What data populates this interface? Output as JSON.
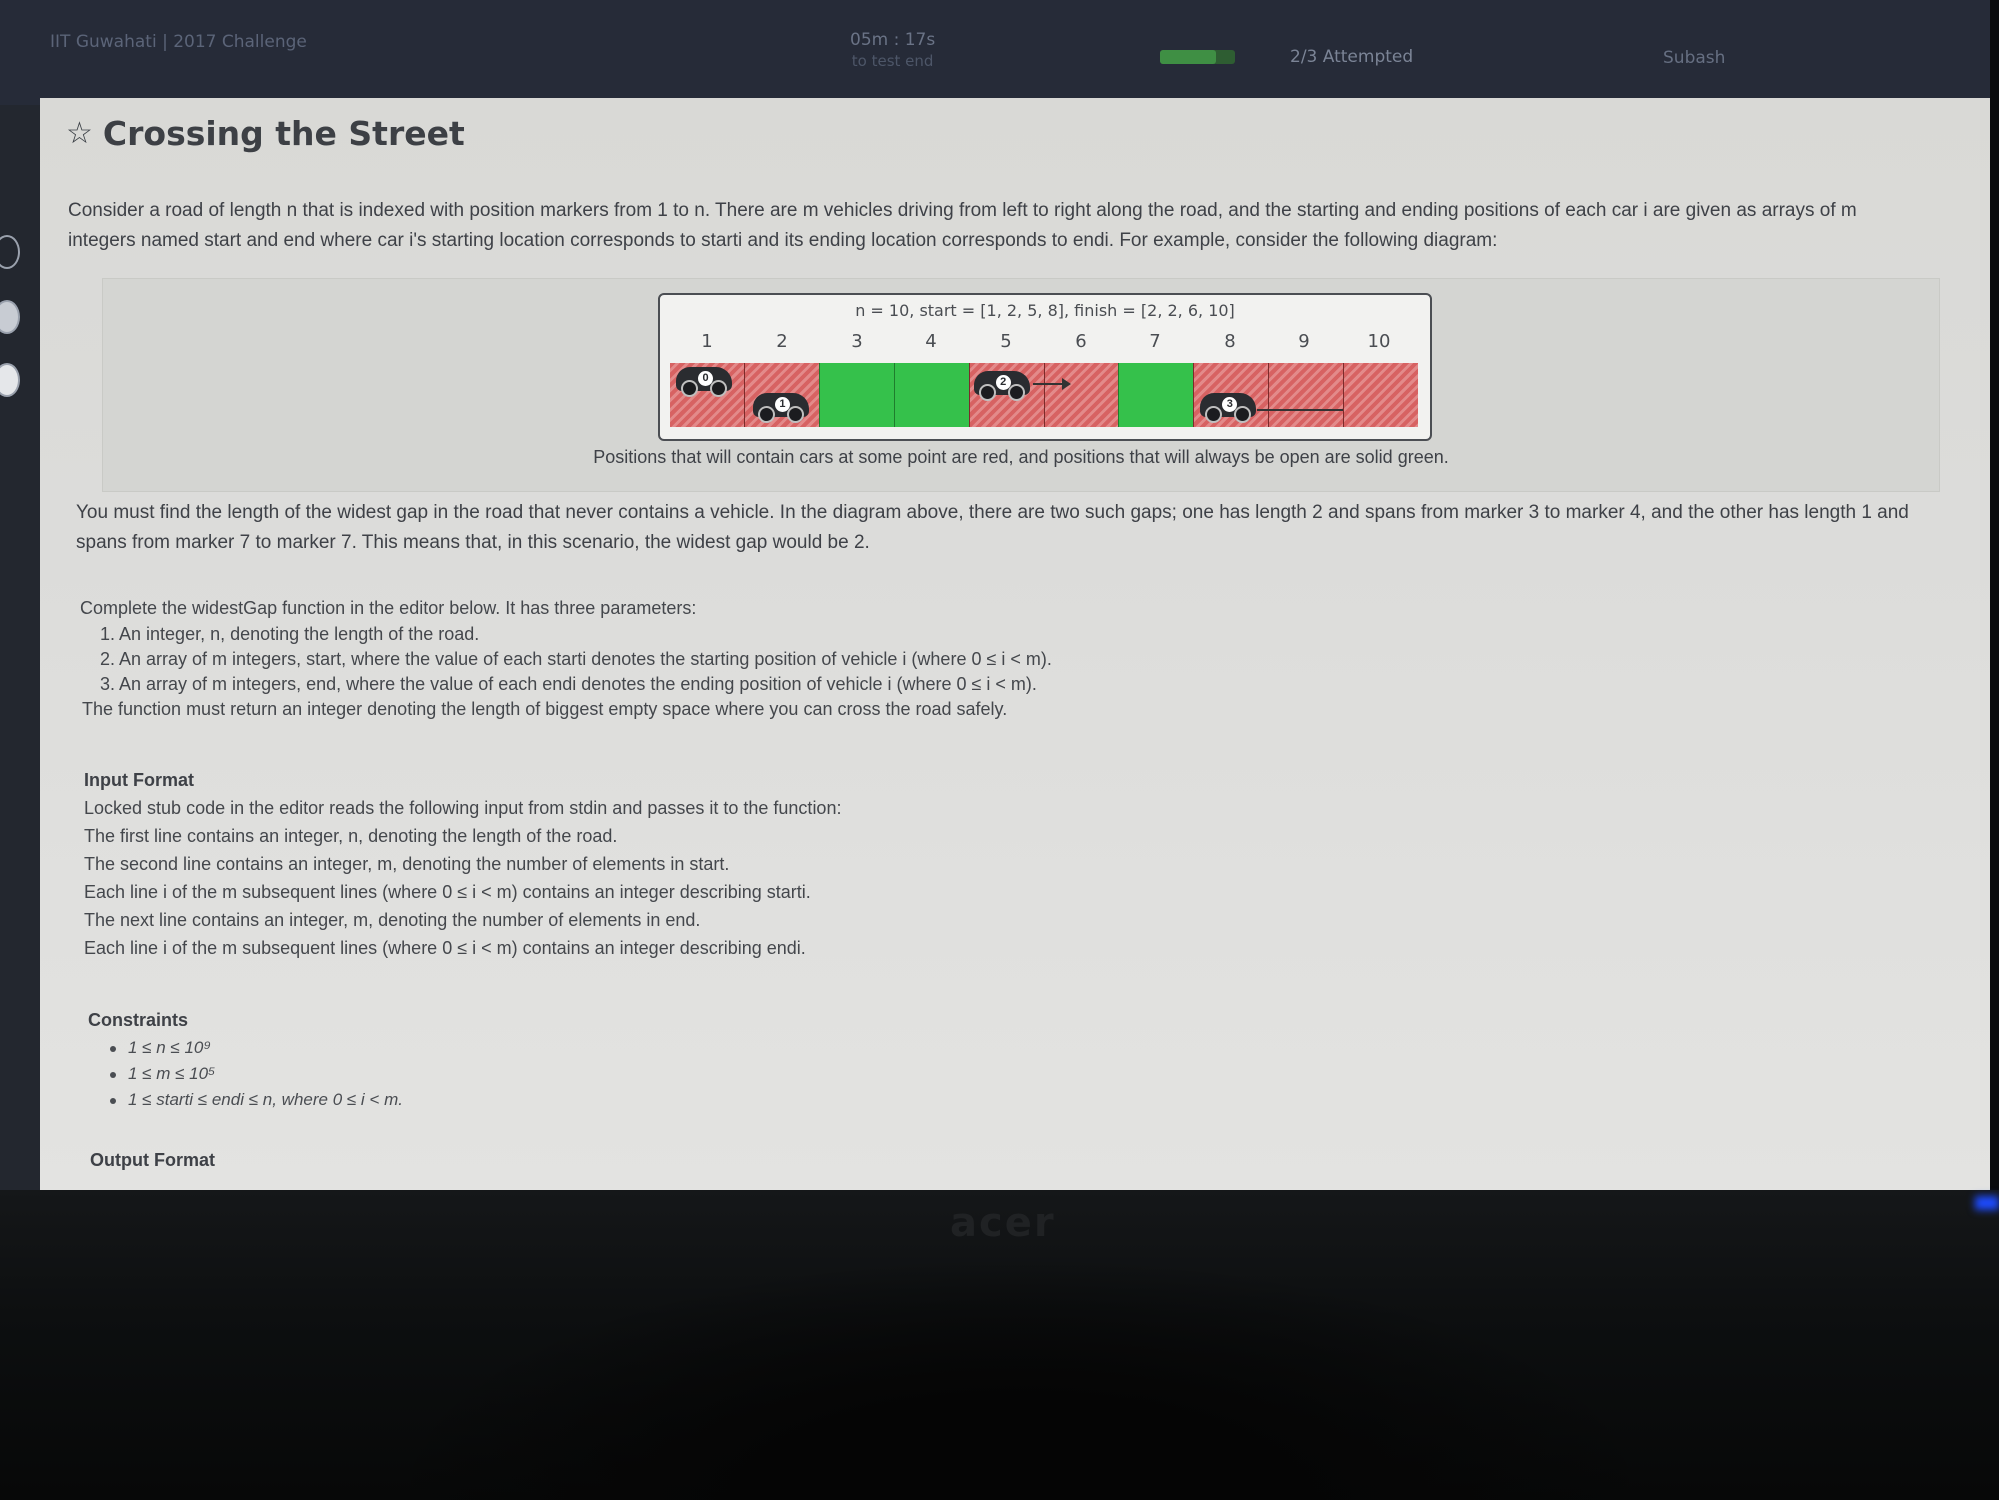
{
  "topbar": {
    "brand": "IIT Guwahati | 2017 Challenge",
    "timer": "05m : 17s",
    "timer_sub": "to test end",
    "attempted": "2/3 Attempted",
    "user": "Subash"
  },
  "problem": {
    "title": "Crossing the Street",
    "intro_line1": "Consider a road of length n that is indexed with position markers from 1 to n. There are m vehicles driving from left to right along the road, and the starting and ending positions of each car i are given as arrays of m",
    "intro_line2": "integers named start and end where car i's starting location corresponds to starti and its ending location corresponds to endi. For example, consider the following diagram:",
    "diagram": {
      "header": "n = 10, start = [1, 2, 5, 8], finish = [2, 2, 6, 10]",
      "markers": [
        "1",
        "2",
        "3",
        "4",
        "5",
        "6",
        "7",
        "8",
        "9",
        "10"
      ],
      "cars": [
        "0",
        "1",
        "2",
        "3"
      ],
      "caption": "Positions that will contain cars at some point are red, and positions that will always be open are solid green."
    },
    "gap_line1": "You must find the length of the widest gap in the road that never contains a vehicle. In the diagram above, there are two such gaps; one has length 2 and spans from marker 3 to marker 4, and the other has length 1 and",
    "gap_line2": "spans from marker 7 to marker 7. This means that, in this scenario, the widest gap would be 2.",
    "complete_intro": "Complete the widestGap function in the editor below. It has three parameters:",
    "params": [
      "1. An integer, n, denoting the length of the road.",
      "2. An array of m integers, start, where the value of each starti denotes the starting position of vehicle i (where 0 ≤ i < m).",
      "3. An array of m integers, end, where the value of each endi denotes the ending position of vehicle i (where 0 ≤ i < m)."
    ],
    "return_line": "The function must return an integer denoting the length of biggest empty space where you can cross the road safely.",
    "input_heading": "Input Format",
    "input_lines": [
      "Locked stub code in the editor reads the following input from stdin and passes it to the function:",
      "The first line contains an integer, n, denoting the length of the road.",
      "The second line contains an integer, m, denoting the number of elements in start.",
      "Each line i of the m subsequent lines (where 0 ≤ i < m) contains an integer describing starti.",
      "The next line contains an integer, m, denoting the number of elements in end.",
      "Each line i of the m subsequent lines (where 0 ≤ i < m) contains an integer describing endi."
    ],
    "constraints_heading": "Constraints",
    "constraints": [
      "1 ≤ n ≤ 10⁹",
      "1 ≤ m ≤ 10⁵",
      "1 ≤ starti ≤ endi ≤ n, where 0 ≤ i < m."
    ],
    "output_heading": "Output Format"
  },
  "monitor": {
    "brand": "acer"
  }
}
